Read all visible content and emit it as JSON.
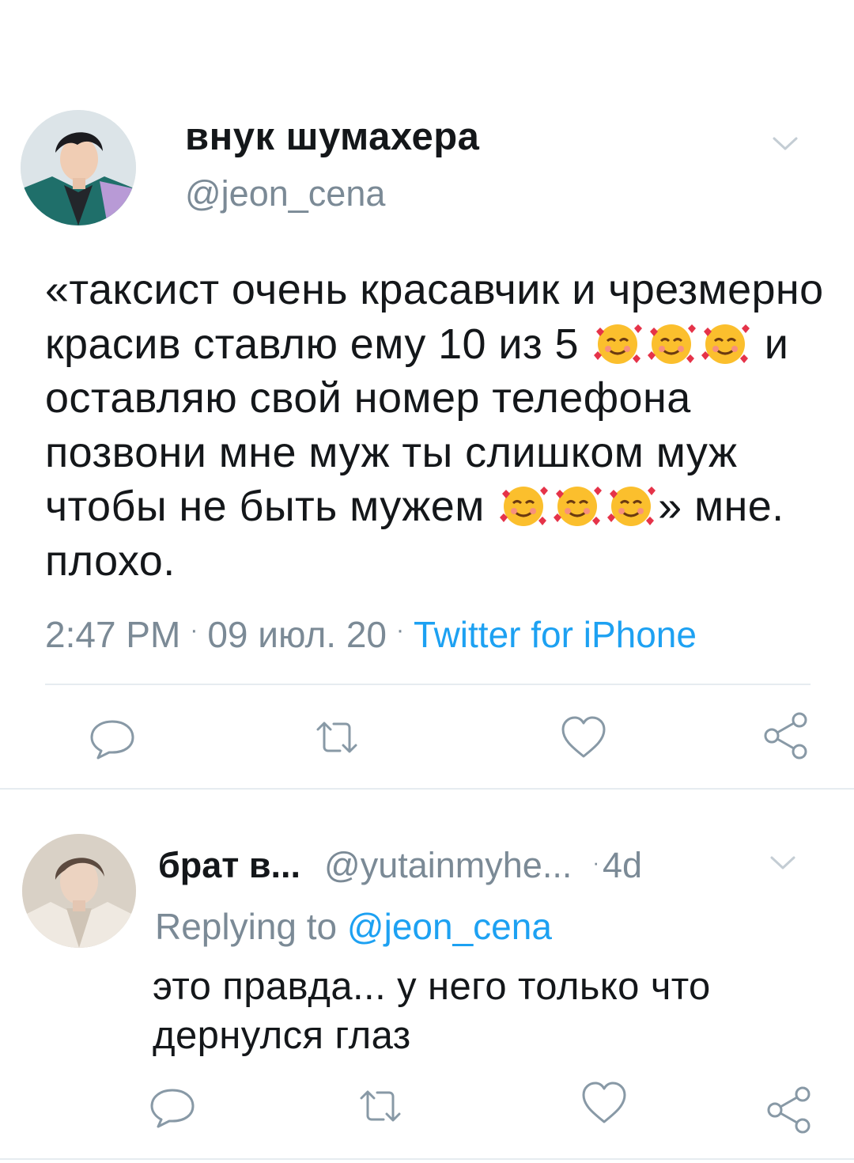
{
  "tweet": {
    "display_name": "внук шумахера",
    "handle": "@jeon_cena",
    "text_parts": [
      "«таксист очень красавчик и чрезмерно красив ставлю ему 10 из 5",
      "и оставляю свой номер телефона позвони мне муж ты слишком муж чтобы не быть мужем",
      "» мне. плохо."
    ],
    "emoji": "smiling-face-with-hearts",
    "time": "2:47 PM",
    "date": "09 июл. 20",
    "source": "Twitter for iPhone",
    "separator": "·"
  },
  "reply": {
    "display_name": "брат в...",
    "handle": "@yutainmyhe...",
    "time": "4d",
    "replying_prefix": "Replying to",
    "replying_mention": "@jeon_cena",
    "text": "это правда... у него только что дернулся глаз"
  },
  "actions": [
    "reply-icon",
    "retweet-icon",
    "like-icon",
    "share-icon"
  ],
  "colors": {
    "text": "#14171a",
    "muted": "#7b8a96",
    "accent": "#1da1f2",
    "icon": "#8899a6",
    "divider": "#e6ecf0"
  }
}
